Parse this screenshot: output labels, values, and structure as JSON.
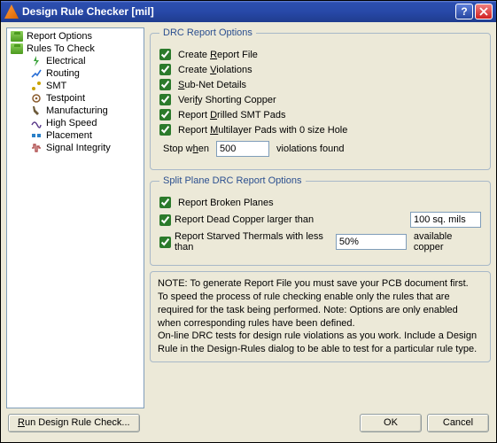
{
  "window": {
    "title": "Design Rule Checker [mil]"
  },
  "tree": {
    "items": [
      {
        "label": "Report Options",
        "type": "top"
      },
      {
        "label": "Rules To Check",
        "type": "top"
      },
      {
        "label": "Electrical",
        "type": "child"
      },
      {
        "label": "Routing",
        "type": "child"
      },
      {
        "label": "SMT",
        "type": "child"
      },
      {
        "label": "Testpoint",
        "type": "child"
      },
      {
        "label": "Manufacturing",
        "type": "child"
      },
      {
        "label": "High Speed",
        "type": "child"
      },
      {
        "label": "Placement",
        "type": "child"
      },
      {
        "label": "Signal Integrity",
        "type": "child"
      }
    ]
  },
  "group1": {
    "legend": "DRC Report Options",
    "create_report": "Create Report File",
    "create_violations": "Create Violations",
    "subnet": "Sub-Net Details",
    "shorting": "Verify Shorting Copper",
    "drilled": "Report Drilled SMT Pads",
    "multilayer": "Report Multilayer Pads with 0 size Hole",
    "stop_prefix": "Stop when",
    "stop_value": "500",
    "stop_suffix": "violations found"
  },
  "group2": {
    "legend": "Split Plane DRC Report Options",
    "broken": "Report Broken Planes",
    "deadcopper": "Report Dead Copper larger than",
    "deadcopper_val": "100 sq. mils",
    "starved": "Report Starved Thermals with less than",
    "starved_val": "50%",
    "starved_tail": "available copper"
  },
  "note": {
    "l1": "NOTE: To generate Report File you must save your PCB document first.",
    "l2": "To speed the process of rule checking enable only the rules that are required for the task being performed.  Note: Options are only enabled when corresponding rules have been defined.",
    "l3": "On-line DRC tests for design rule violations as you work. Include a Design Rule in the Design-Rules dialog to be able to test for a particular rule  type."
  },
  "footer": {
    "run": "Run Design Rule Check...",
    "ok": "OK",
    "cancel": "Cancel"
  }
}
